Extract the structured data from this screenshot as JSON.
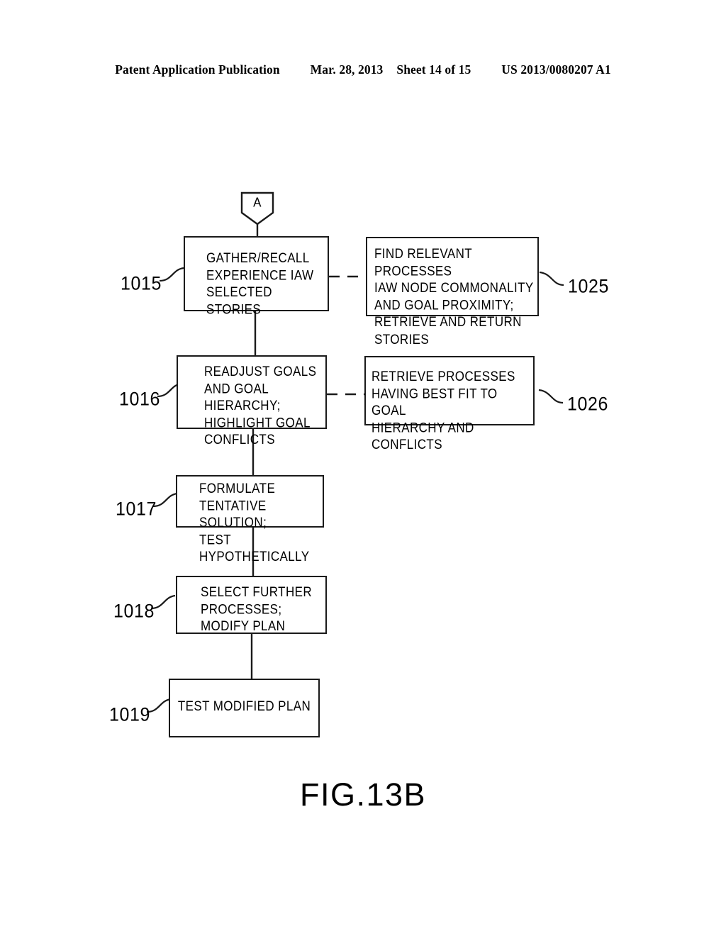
{
  "header": {
    "publication": "Patent Application Publication",
    "date": "Mar. 28, 2013",
    "sheet": "Sheet 14 of 15",
    "patent_number": "US 2013/0080207 A1"
  },
  "figure": {
    "caption": "FIG.13B",
    "connector_label": "A"
  },
  "nodes": {
    "n1015": {
      "ref": "1015",
      "text": "GATHER/RECALL\nEXPERIENCE IAW\nSELECTED STORIES"
    },
    "n1025": {
      "ref": "1025",
      "text": "FIND RELEVANT PROCESSES\nIAW NODE COMMONALITY\nAND GOAL PROXIMITY;\nRETRIEVE AND RETURN STORIES"
    },
    "n1016": {
      "ref": "1016",
      "text": "READJUST GOALS\nAND GOAL HIERARCHY;\nHIGHLIGHT GOAL\nCONFLICTS"
    },
    "n1026": {
      "ref": "1026",
      "text": "RETRIEVE PROCESSES\nHAVING BEST FIT TO GOAL\nHIERARCHY AND CONFLICTS"
    },
    "n1017": {
      "ref": "1017",
      "text": "FORMULATE\nTENTATIVE SOLUTION;\nTEST HYPOTHETICALLY"
    },
    "n1018": {
      "ref": "1018",
      "text": "SELECT FURTHER\nPROCESSES;\nMODIFY PLAN"
    },
    "n1019": {
      "ref": "1019",
      "text": "TEST MODIFIED PLAN"
    }
  },
  "colors": {
    "ink": "#1a1a1a",
    "paper": "#ffffff"
  }
}
